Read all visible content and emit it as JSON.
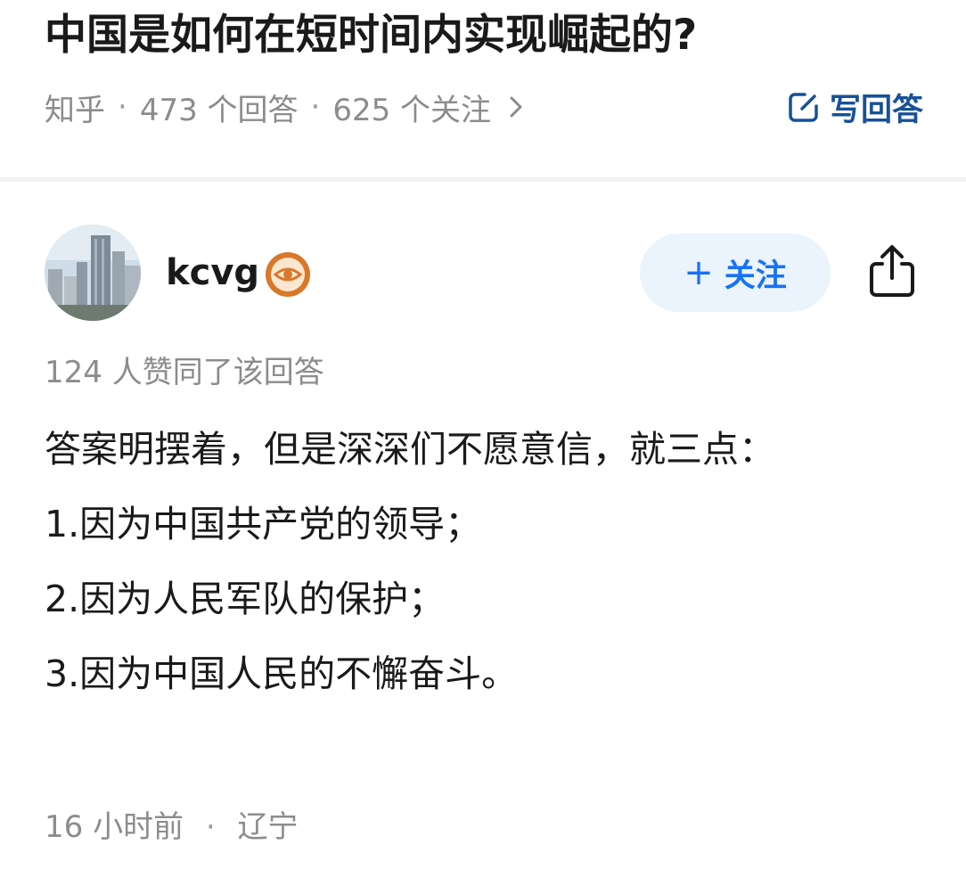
{
  "question": {
    "title": "中国是如何在短时间内实现崛起的?",
    "source": "知乎",
    "answer_count": "473 个回答",
    "follower_count": "625 个关注",
    "write_answer_label": "写回答"
  },
  "answer": {
    "author": {
      "name": "kcvg"
    },
    "follow_label": "关注",
    "vote_text": "124 人赞同了该回答",
    "paragraphs": [
      "答案明摆着，但是深深们不愿意信，就三点：",
      "1.因为中国共产党的领导；",
      "2.因为人民军队的保护；",
      "3.因为中国人民的不懈奋斗。"
    ],
    "time": "16 小时前",
    "location": "辽宁"
  },
  "colors": {
    "accent": "#1772f6",
    "link": "#175199",
    "muted": "#8c8c8c",
    "follow_bg": "#ebf3fd",
    "badge": "#d9772b"
  },
  "icons": {
    "meta": "chevron-right-icon",
    "write": "edit-icon",
    "share": "share-icon",
    "badge": "eye-badge-icon"
  }
}
